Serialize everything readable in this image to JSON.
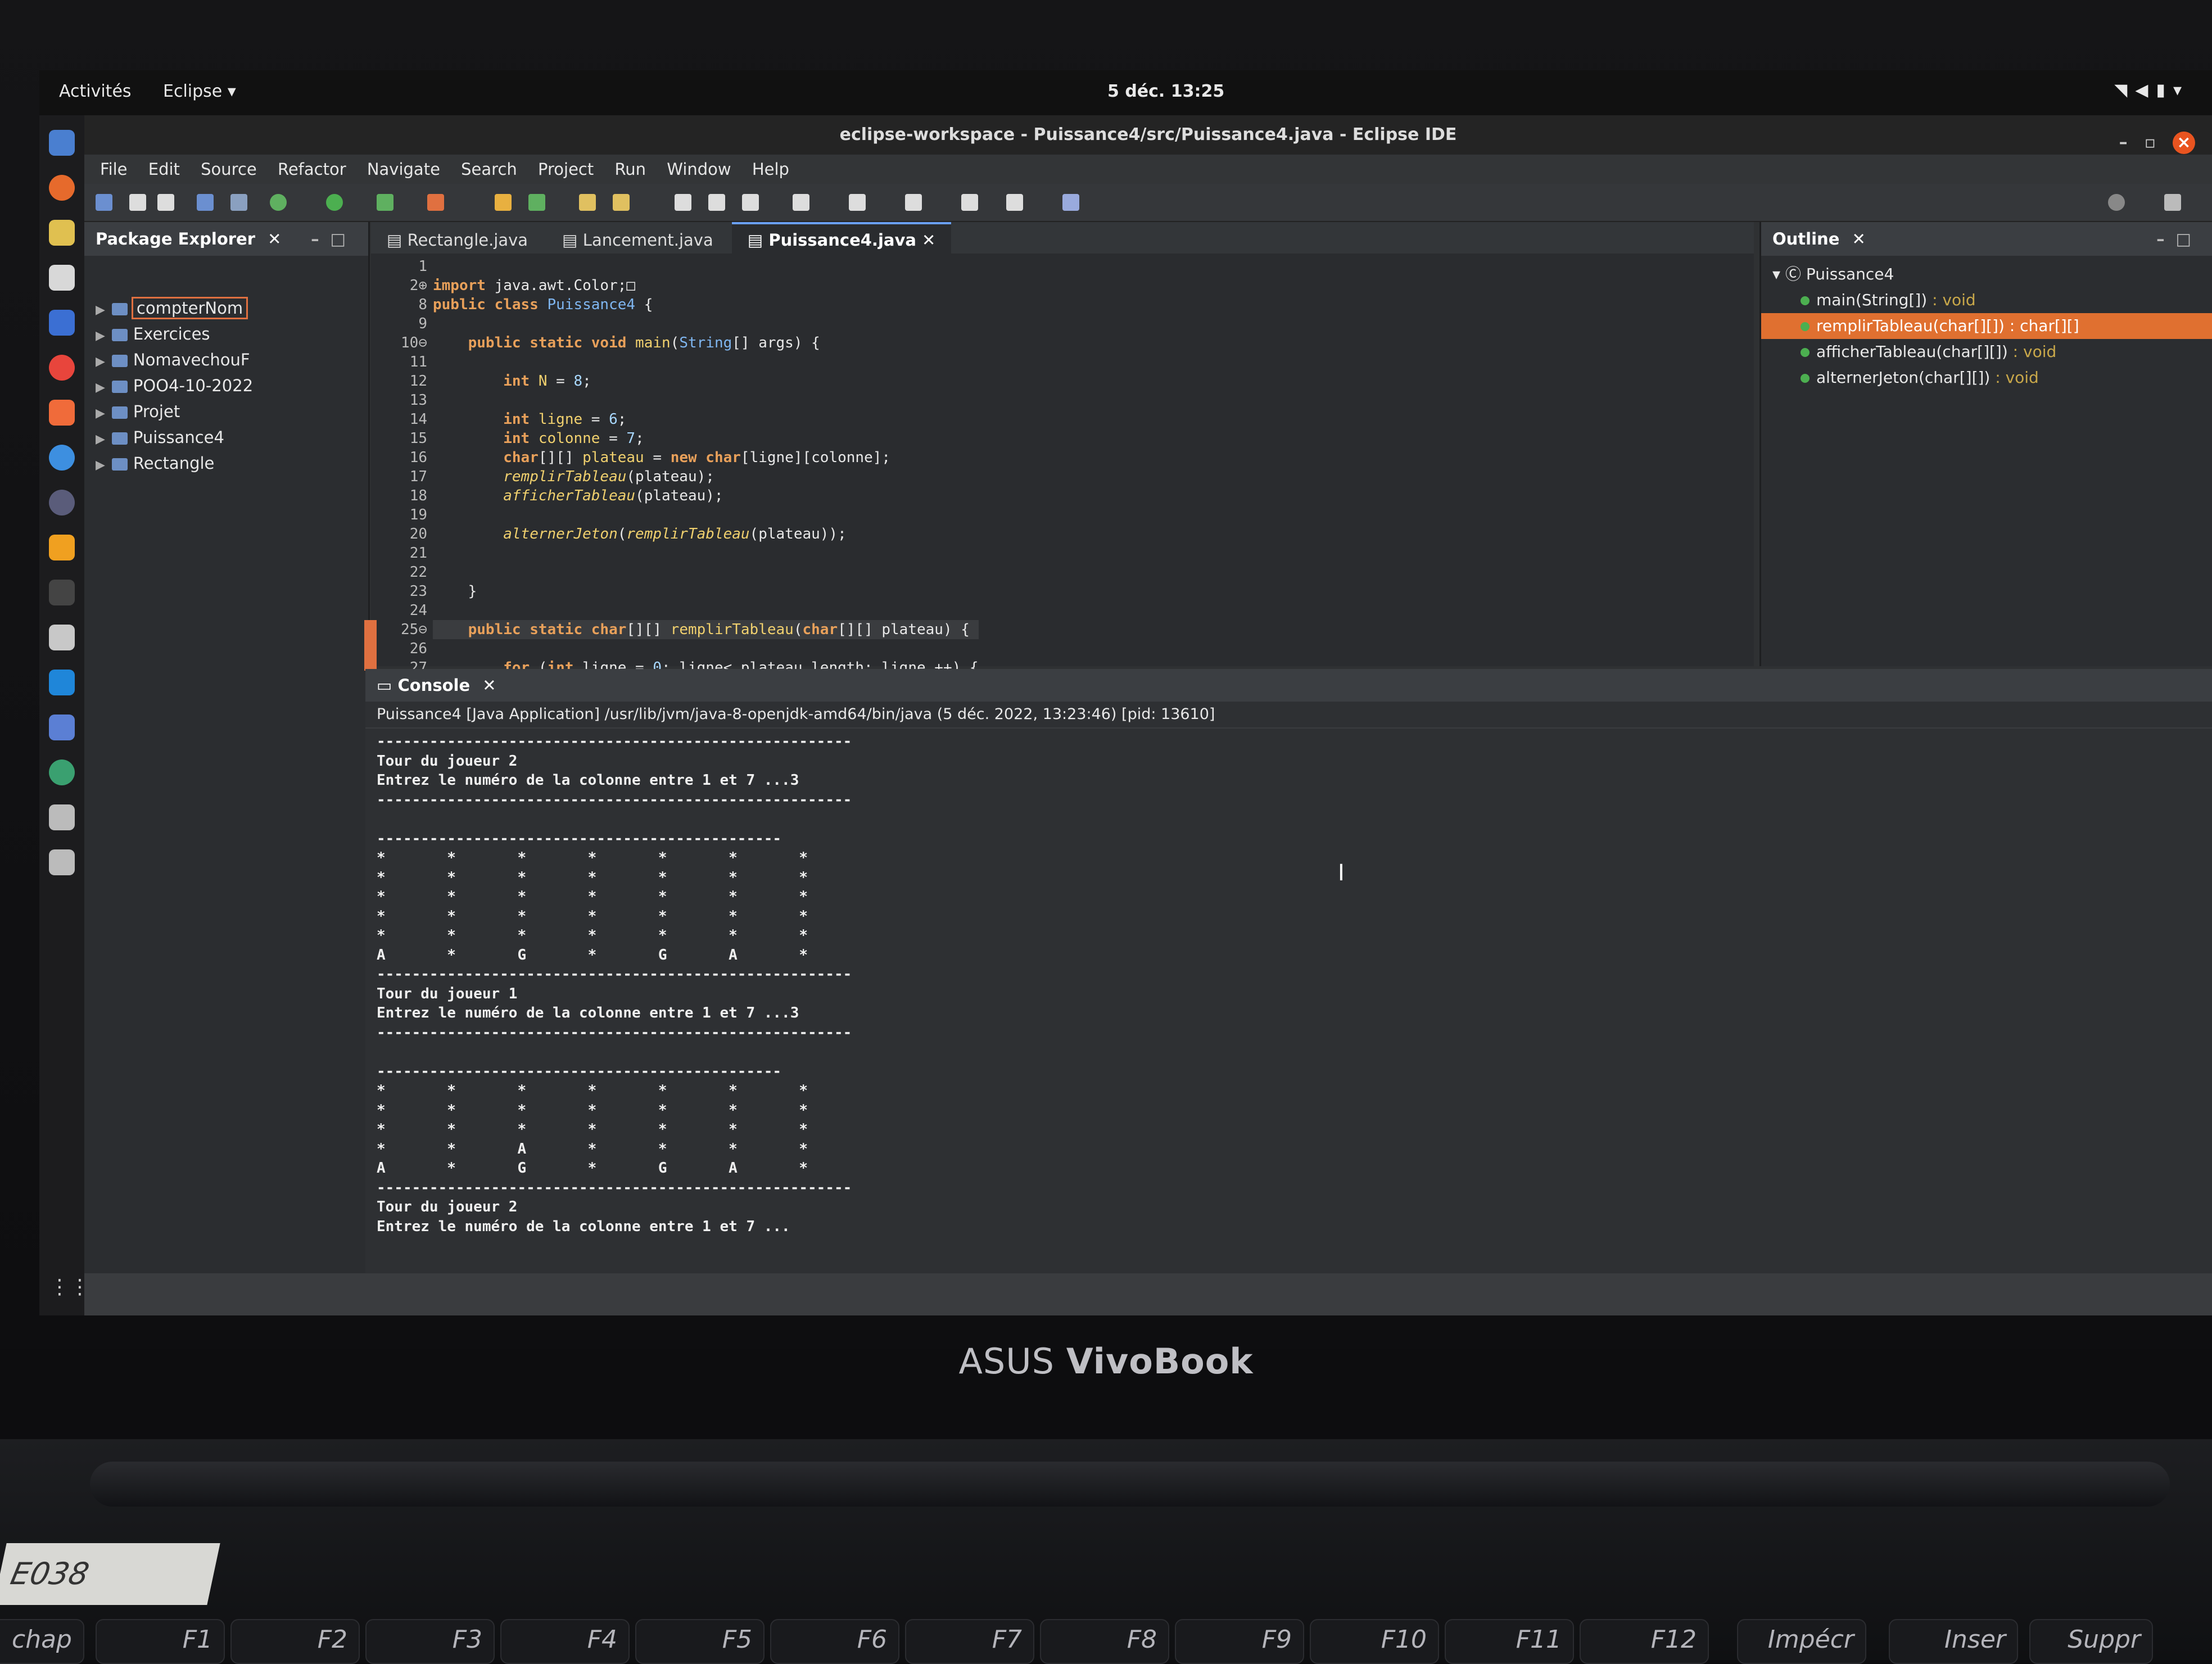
{
  "desktop": {
    "activities": "Activités",
    "app_menu": "Eclipse",
    "clock": "5 déc. 13:25"
  },
  "window": {
    "title": "eclipse-workspace - Puissance4/src/Puissance4.java - Eclipse IDE"
  },
  "menu": [
    "File",
    "Edit",
    "Source",
    "Refactor",
    "Navigate",
    "Search",
    "Project",
    "Run",
    "Window",
    "Help"
  ],
  "package_explorer": {
    "title": "Package Explorer",
    "projects": [
      "compterNom",
      "Exercices",
      "NomavechouF",
      "POO4-10-2022",
      "Projet",
      "Puissance4",
      "Rectangle"
    ]
  },
  "editor": {
    "tabs": [
      "Rectangle.java",
      "Lancement.java",
      "Puissance4.java"
    ],
    "line_numbers": [
      "1",
      "2⊕",
      "8",
      "9",
      "10⊖",
      "11",
      "12",
      "13",
      "14",
      "15",
      "16",
      "17",
      "18",
      "19",
      "20",
      "21",
      "22",
      "23",
      "24",
      "25⊖",
      "26",
      "27"
    ]
  },
  "outline": {
    "title": "Outline",
    "root": "Puissance4",
    "items": [
      {
        "name": "main(String[])",
        "ret": " : void"
      },
      {
        "name": "remplirTableau(char[][])",
        "ret": " : char[][]"
      },
      {
        "name": "afficherTableau(char[][])",
        "ret": " : void"
      },
      {
        "name": "alternerJeton(char[][])",
        "ret": " : void"
      }
    ]
  },
  "console": {
    "title": "Console",
    "header": "Puissance4 [Java Application] /usr/lib/jvm/java-8-openjdk-amd64/bin/java  (5 déc. 2022, 13:23:46) [pid: 13610]",
    "lines": [
      "------------------------------------------------------",
      "Tour du joueur 2",
      "Entrez le numéro de la colonne entre 1 et 7 ...3",
      "------------------------------------------------------",
      "",
      "----------------------------------------------",
      "*       *       *       *       *       *       *",
      "*       *       *       *       *       *       *",
      "*       *       *       *       *       *       *",
      "*       *       *       *       *       *       *",
      "*       *       *       *       *       *       *",
      "A       *       G       *       G       A       *",
      "------------------------------------------------------",
      "Tour du joueur 1",
      "Entrez le numéro de la colonne entre 1 et 7 ...3",
      "------------------------------------------------------",
      "",
      "----------------------------------------------",
      "*       *       *       *       *       *       *",
      "*       *       *       *       *       *       *",
      "*       *       *       *       *       *       *",
      "*       *       A       *       *       *       *",
      "A       *       G       *       G       A       *",
      "------------------------------------------------------",
      "Tour du joueur 2",
      "Entrez le numéro de la colonne entre 1 et 7 ..."
    ]
  },
  "laptop": {
    "brand_prefix": "ASUS",
    "brand_name": "VivoBook",
    "asset_tag": "E038",
    "keys": [
      "chap",
      "F1",
      "F2",
      "F3",
      "F4",
      "F5",
      "F6",
      "F7",
      "F8",
      "F9",
      "F10",
      "F11",
      "F12",
      "Impécr",
      "Inser",
      "Suppr"
    ]
  },
  "colors": {
    "selection": "#e07030",
    "keyword": "#e8a05a",
    "method": "#f0d06e"
  }
}
